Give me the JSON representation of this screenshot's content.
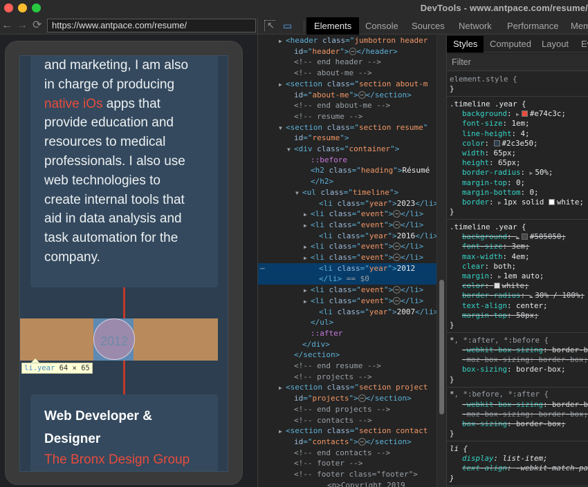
{
  "window": {
    "title": "DevTools - www.antpace.com/resume/"
  },
  "browser": {
    "url": "https://www.antpace.com/resume/",
    "nav_icons": {
      "back": "←",
      "forward": "→",
      "reload": "⟳"
    }
  },
  "page": {
    "about_lines": [
      "and marketing, I am also",
      "in charge of producing",
      "apps that",
      "provide education and",
      "resources to medical",
      "professionals. I also use",
      "web technologies to",
      "create internal tools that",
      "aid in data analysis and",
      "task automation for the",
      "company."
    ],
    "about_highlight": "native iOs",
    "timeline_year": "2012",
    "tooltip": {
      "tag": "li",
      "cls": ".year",
      "size": "64 × 65"
    },
    "job": {
      "title_line1": "Web Developer &",
      "title_line2": "Designer",
      "company": "The Bronx Design Group"
    }
  },
  "devtools": {
    "main_tabs": [
      "Elements",
      "Console",
      "Sources",
      "Network",
      "Performance",
      "Mem"
    ],
    "active_main_tab": "Elements",
    "side_tabs": [
      "Styles",
      "Computed",
      "Layout",
      "Ev"
    ],
    "active_side_tab": "Styles",
    "filter_placeholder": "Filter",
    "dom": [
      {
        "indent": 0,
        "arrow": "▶",
        "parts": [
          [
            "tg",
            "<header "
          ],
          [
            "at",
            "class"
          ],
          [
            "tg",
            "=\""
          ],
          [
            "av",
            "jumbotron header"
          ]
        ]
      },
      {
        "indent": 1,
        "parts": [
          [
            "at",
            "id"
          ],
          [
            "tg",
            "=\""
          ],
          [
            "av",
            "header"
          ],
          [
            "tg",
            "\">"
          ],
          [
            "ell",
            "⋯"
          ],
          [
            "tg",
            "</header>"
          ]
        ]
      },
      {
        "indent": 1,
        "parts": [
          [
            "cm",
            "<!-- end header -->"
          ]
        ]
      },
      {
        "indent": 1,
        "parts": [
          [
            "cm",
            "<!-- about-me -->"
          ]
        ]
      },
      {
        "indent": 0,
        "arrow": "▶",
        "parts": [
          [
            "tg",
            "<section "
          ],
          [
            "at",
            "class"
          ],
          [
            "tg",
            "=\""
          ],
          [
            "av",
            "section about-m"
          ]
        ]
      },
      {
        "indent": 1,
        "parts": [
          [
            "at",
            "id"
          ],
          [
            "tg",
            "=\""
          ],
          [
            "av",
            "about-me"
          ],
          [
            "tg",
            "\">"
          ],
          [
            "ell",
            "⋯"
          ],
          [
            "tg",
            "</section>"
          ]
        ]
      },
      {
        "indent": 1,
        "parts": [
          [
            "cm",
            "<!-- end about-me -->"
          ]
        ]
      },
      {
        "indent": 1,
        "parts": [
          [
            "cm",
            "<!-- resume -->"
          ]
        ]
      },
      {
        "indent": 0,
        "arrow": "▼",
        "parts": [
          [
            "tg",
            "<section "
          ],
          [
            "at",
            "class"
          ],
          [
            "tg",
            "=\""
          ],
          [
            "av",
            "section resume"
          ],
          [
            "tg",
            "\""
          ]
        ]
      },
      {
        "indent": 1,
        "parts": [
          [
            "at",
            "id"
          ],
          [
            "tg",
            "=\""
          ],
          [
            "av",
            "resume"
          ],
          [
            "tg",
            "\">"
          ]
        ]
      },
      {
        "indent": 1,
        "arrow": "▼",
        "parts": [
          [
            "tg",
            "<div "
          ],
          [
            "at",
            "class"
          ],
          [
            "tg",
            "=\""
          ],
          [
            "av",
            "container"
          ],
          [
            "tg",
            "\">"
          ]
        ]
      },
      {
        "indent": 3,
        "parts": [
          [
            "ps",
            "::before"
          ]
        ]
      },
      {
        "indent": 3,
        "parts": [
          [
            "tg",
            "<h2 "
          ],
          [
            "at",
            "class"
          ],
          [
            "tg",
            "=\""
          ],
          [
            "av",
            "heading"
          ],
          [
            "tg",
            "\">"
          ],
          [
            "tx",
            "Résumé"
          ]
        ]
      },
      {
        "indent": 3,
        "parts": [
          [
            "tg",
            "</h2>"
          ]
        ]
      },
      {
        "indent": 2,
        "arrow": "▼",
        "parts": [
          [
            "tg",
            "<ul "
          ],
          [
            "at",
            "class"
          ],
          [
            "tg",
            "=\""
          ],
          [
            "av",
            "timeline"
          ],
          [
            "tg",
            "\">"
          ]
        ]
      },
      {
        "indent": 4,
        "parts": [
          [
            "tg",
            "<li "
          ],
          [
            "at",
            "class"
          ],
          [
            "tg",
            "=\""
          ],
          [
            "av",
            "year"
          ],
          [
            "tg",
            "\">"
          ],
          [
            "tx",
            "2023"
          ],
          [
            "tg",
            "</li>"
          ]
        ]
      },
      {
        "indent": 3,
        "arrow": "▶",
        "parts": [
          [
            "tg",
            "<li "
          ],
          [
            "at",
            "class"
          ],
          [
            "tg",
            "=\""
          ],
          [
            "av",
            "event"
          ],
          [
            "tg",
            "\">"
          ],
          [
            "ell",
            "⋯"
          ],
          [
            "tg",
            "</li>"
          ]
        ]
      },
      {
        "indent": 3,
        "arrow": "▶",
        "parts": [
          [
            "tg",
            "<li "
          ],
          [
            "at",
            "class"
          ],
          [
            "tg",
            "=\""
          ],
          [
            "av",
            "event"
          ],
          [
            "tg",
            "\">"
          ],
          [
            "ell",
            "⋯"
          ],
          [
            "tg",
            "</li>"
          ]
        ]
      },
      {
        "indent": 4,
        "parts": [
          [
            "tg",
            "<li "
          ],
          [
            "at",
            "class"
          ],
          [
            "tg",
            "=\""
          ],
          [
            "av",
            "year"
          ],
          [
            "tg",
            "\">"
          ],
          [
            "tx",
            "2016"
          ],
          [
            "tg",
            "</li>"
          ]
        ]
      },
      {
        "indent": 3,
        "arrow": "▶",
        "parts": [
          [
            "tg",
            "<li "
          ],
          [
            "at",
            "class"
          ],
          [
            "tg",
            "=\""
          ],
          [
            "av",
            "event"
          ],
          [
            "tg",
            "\">"
          ],
          [
            "ell",
            "⋯"
          ],
          [
            "tg",
            "</li>"
          ]
        ]
      },
      {
        "indent": 3,
        "arrow": "▶",
        "parts": [
          [
            "tg",
            "<li "
          ],
          [
            "at",
            "class"
          ],
          [
            "tg",
            "=\""
          ],
          [
            "av",
            "event"
          ],
          [
            "tg",
            "\">"
          ],
          [
            "ell",
            "⋯"
          ],
          [
            "tg",
            "</li>"
          ]
        ]
      },
      {
        "indent": 4,
        "selected": true,
        "dots": "⋯",
        "parts": [
          [
            "tg",
            "<li "
          ],
          [
            "at",
            "class"
          ],
          [
            "tg",
            "=\""
          ],
          [
            "av",
            "year"
          ],
          [
            "tg",
            "\">"
          ],
          [
            "tx",
            "2012"
          ]
        ]
      },
      {
        "indent": 4,
        "selected": true,
        "parts": [
          [
            "tg",
            "</li>"
          ],
          [
            "cm",
            " == $0"
          ]
        ]
      },
      {
        "indent": 3,
        "arrow": "▶",
        "parts": [
          [
            "tg",
            "<li "
          ],
          [
            "at",
            "class"
          ],
          [
            "tg",
            "=\""
          ],
          [
            "av",
            "event"
          ],
          [
            "tg",
            "\">"
          ],
          [
            "ell",
            "⋯"
          ],
          [
            "tg",
            "</li>"
          ]
        ]
      },
      {
        "indent": 3,
        "arrow": "▶",
        "parts": [
          [
            "tg",
            "<li "
          ],
          [
            "at",
            "class"
          ],
          [
            "tg",
            "=\""
          ],
          [
            "av",
            "event"
          ],
          [
            "tg",
            "\">"
          ],
          [
            "ell",
            "⋯"
          ],
          [
            "tg",
            "</li>"
          ]
        ]
      },
      {
        "indent": 4,
        "parts": [
          [
            "tg",
            "<li "
          ],
          [
            "at",
            "class"
          ],
          [
            "tg",
            "=\""
          ],
          [
            "av",
            "year"
          ],
          [
            "tg",
            "\">"
          ],
          [
            "tx",
            "2007"
          ],
          [
            "tg",
            "</li>"
          ]
        ]
      },
      {
        "indent": 3,
        "parts": [
          [
            "tg",
            "</ul>"
          ]
        ]
      },
      {
        "indent": 3,
        "parts": [
          [
            "ps",
            "::after"
          ]
        ]
      },
      {
        "indent": 2,
        "parts": [
          [
            "tg",
            "</div>"
          ]
        ]
      },
      {
        "indent": 1,
        "parts": [
          [
            "tg",
            "</section>"
          ]
        ]
      },
      {
        "indent": 1,
        "parts": [
          [
            "cm",
            "<!-- end resume -->"
          ]
        ]
      },
      {
        "indent": 1,
        "parts": [
          [
            "cm",
            "<!-- projects -->"
          ]
        ]
      },
      {
        "indent": 0,
        "arrow": "▶",
        "parts": [
          [
            "tg",
            "<section "
          ],
          [
            "at",
            "class"
          ],
          [
            "tg",
            "=\""
          ],
          [
            "av",
            "section project"
          ]
        ]
      },
      {
        "indent": 1,
        "parts": [
          [
            "at",
            "id"
          ],
          [
            "tg",
            "=\""
          ],
          [
            "av",
            "projects"
          ],
          [
            "tg",
            "\">"
          ],
          [
            "ell",
            "⋯"
          ],
          [
            "tg",
            "</section>"
          ]
        ]
      },
      {
        "indent": 1,
        "parts": [
          [
            "cm",
            "<!-- end projects -->"
          ]
        ]
      },
      {
        "indent": 1,
        "parts": [
          [
            "cm",
            "<!-- contacts -->"
          ]
        ]
      },
      {
        "indent": 0,
        "arrow": "▶",
        "parts": [
          [
            "tg",
            "<section "
          ],
          [
            "at",
            "class"
          ],
          [
            "tg",
            "=\""
          ],
          [
            "av",
            "section contact"
          ]
        ]
      },
      {
        "indent": 1,
        "parts": [
          [
            "at",
            "id"
          ],
          [
            "tg",
            "=\""
          ],
          [
            "av",
            "contacts"
          ],
          [
            "tg",
            "\">"
          ],
          [
            "ell",
            "⋯"
          ],
          [
            "tg",
            "</section>"
          ]
        ]
      },
      {
        "indent": 1,
        "parts": [
          [
            "cm",
            "<!-- end contacts -->"
          ]
        ]
      },
      {
        "indent": 1,
        "parts": [
          [
            "cm",
            "<!-- footer -->"
          ]
        ]
      },
      {
        "indent": 1,
        "parts": [
          [
            "cm",
            "<!-- footer class=\"footer\">"
          ]
        ]
      },
      {
        "indent": 5,
        "parts": [
          [
            "cm",
            "<p>Copyright 2019"
          ]
        ]
      }
    ],
    "styles": [
      {
        "selector": "element.style {",
        "props": [],
        "close": "}"
      },
      {
        "selector": ".timeline .year {",
        "props": [
          {
            "name": "background",
            "value": "#e74c3c;",
            "swatch": "#e74c3c",
            "tri": true
          },
          {
            "name": "font-size",
            "value": "1em;"
          },
          {
            "name": "line-height",
            "value": "4;"
          },
          {
            "name": "color",
            "value": "#2c3e50;",
            "swatch": "#2c3e50"
          },
          {
            "name": "width",
            "value": "65px;"
          },
          {
            "name": "height",
            "value": "65px;"
          },
          {
            "name": "border-radius",
            "value": "50%;",
            "tri": true
          },
          {
            "name": "margin-top",
            "value": "0;"
          },
          {
            "name": "margin-bottom",
            "value": "0;"
          },
          {
            "name": "border",
            "value": "1px solid ",
            "tri": true,
            "swatch": "#ffffff",
            "suffix": "white;"
          }
        ],
        "close": "}"
      },
      {
        "selector": ".timeline .year {",
        "props": [
          {
            "name": "background",
            "value": "#505050;",
            "swatch": "#505050",
            "tri": true,
            "strike": true
          },
          {
            "name": "font-size",
            "value": "3em;",
            "strike": true
          },
          {
            "name": "max-width",
            "value": "4em;"
          },
          {
            "name": "clear",
            "value": "both;"
          },
          {
            "name": "margin",
            "value": "1em auto;",
            "tri": true
          },
          {
            "name": "color",
            "value": "white;",
            "swatch": "#ffffff",
            "strike": true
          },
          {
            "name": "border-radius",
            "value": "30% / 100%;",
            "tri": true,
            "strike": true
          },
          {
            "name": "text-align",
            "value": "center;"
          },
          {
            "name": "margin-top",
            "value": "50px;",
            "strike": true
          }
        ],
        "close": "}"
      },
      {
        "selector": "*, *:after, *:before {",
        "selector_main": "*",
        "selector_rest": ", *:after, *:before {",
        "props": [
          {
            "name": "-webkit-box-sizing",
            "value": "border-box;",
            "strike": true
          },
          {
            "name": "-moz-box-sizing",
            "value": "border-box;",
            "strike": true,
            "gray": true
          },
          {
            "name": "box-sizing",
            "value": "border-box;"
          }
        ],
        "close": "}"
      },
      {
        "selector": "*, *:before, *:after {",
        "selector_main": "*",
        "selector_rest": ", *:before, *:after {",
        "props": [
          {
            "name": "-webkit-box-sizing",
            "value": "border-box;",
            "strike": true
          },
          {
            "name": "-moz-box-sizing",
            "value": "border-box;",
            "strike": true,
            "gray": true
          },
          {
            "name": "box-sizing",
            "value": "border-box;",
            "strike": true
          }
        ],
        "close": "}"
      },
      {
        "selector": "li {",
        "italic": true,
        "props": [
          {
            "name": "display",
            "value": "list-item;"
          },
          {
            "name": "text-align",
            "value": "-webkit-match-parent;",
            "strike": true
          }
        ],
        "close": "}"
      }
    ]
  }
}
